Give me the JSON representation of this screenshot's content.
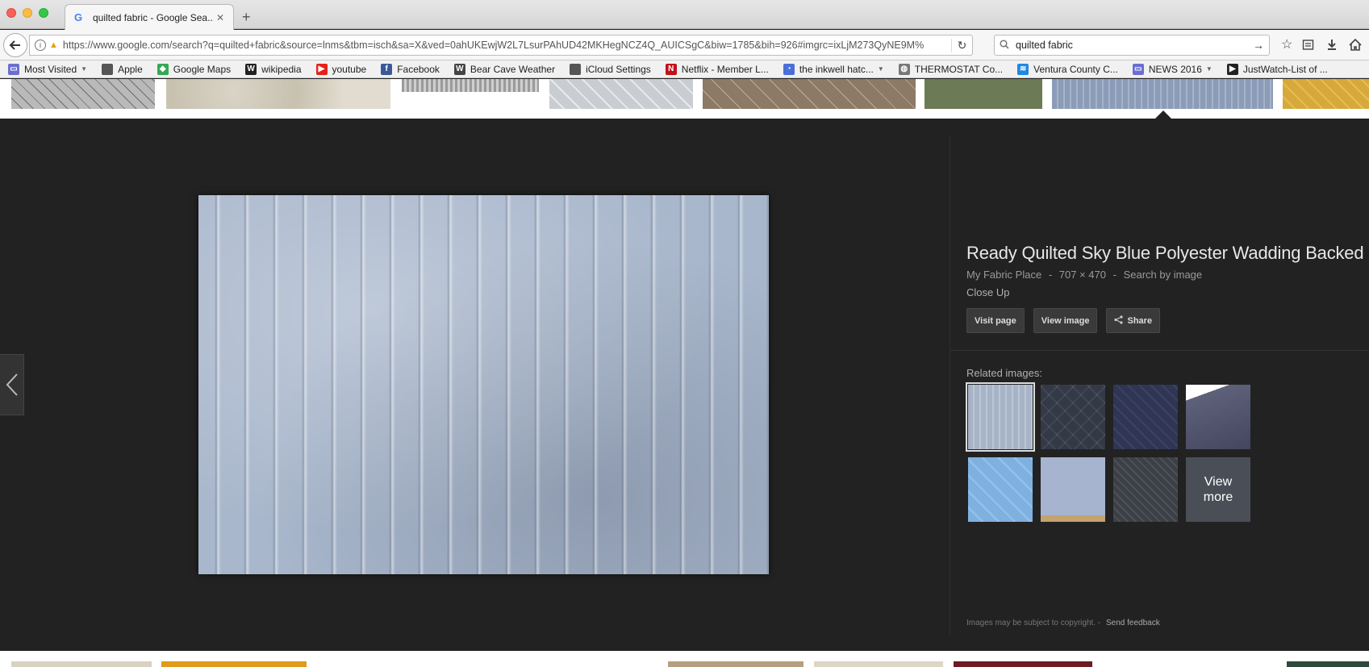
{
  "tab": {
    "title": "quilted fabric - Google Sea...",
    "favicon": "G",
    "close": "✕",
    "new_tab": "+"
  },
  "nav": {
    "url": "https://www.google.com/search?q=quilted+fabric&source=lnms&tbm=isch&sa=X&ved=0ahUKEwjW2L7LsurPAhUD42MKHegNCZ4Q_AUICSgC&biw=1785&bih=926#imgrc=ixLjM273QyNE9M%",
    "search_query": "quilted fabric"
  },
  "bookmarks": [
    {
      "label": "Most Visited",
      "icon": "folder-icon",
      "caret": true,
      "color": "#6a6fcf"
    },
    {
      "label": "Apple",
      "icon": "apple-icon",
      "caret": false,
      "color": "#555555"
    },
    {
      "label": "Google Maps",
      "icon": "maps-icon",
      "caret": false,
      "color": "#34a853"
    },
    {
      "label": "wikipedia",
      "icon": "wikipedia-icon",
      "caret": false,
      "color": "#222222"
    },
    {
      "label": "youtube",
      "icon": "youtube-icon",
      "caret": false,
      "color": "#e62117"
    },
    {
      "label": "Facebook",
      "icon": "facebook-icon",
      "caret": false,
      "color": "#3b5998"
    },
    {
      "label": "Bear Cave Weather",
      "icon": "weather-icon",
      "caret": false,
      "color": "#444444"
    },
    {
      "label": "iCloud Settings",
      "icon": "apple-icon",
      "caret": false,
      "color": "#555555"
    },
    {
      "label": "Netflix - Member L...",
      "icon": "netflix-icon",
      "caret": false,
      "color": "#c11119"
    },
    {
      "label": "the inkwell hatc...",
      "icon": "rss-icon",
      "caret": true,
      "color": "#4a6fd6"
    },
    {
      "label": "THERMOSTAT Co...",
      "icon": "globe-icon",
      "caret": false,
      "color": "#777777"
    },
    {
      "label": "Ventura County C...",
      "icon": "ventura-icon",
      "caret": false,
      "color": "#1e88e5"
    },
    {
      "label": "NEWS 2016",
      "icon": "folder-icon",
      "caret": true,
      "color": "#6a6fcf"
    },
    {
      "label": "JustWatch-List of ...",
      "icon": "justwatch-icon",
      "caret": false,
      "color": "#222222"
    }
  ],
  "detail": {
    "title": "Ready Quilted Sky Blue Polyester Wadding Backed",
    "source": "My Fabric Place",
    "sep1": "-",
    "dimensions": "707 × 470",
    "sep2": "-",
    "search_by_image": "Search by image",
    "description": "Close Up",
    "actions": {
      "visit": "Visit page",
      "view": "View image",
      "share": "Share"
    },
    "related_label": "Related images:",
    "view_more_line1": "View",
    "view_more_line2": "more",
    "copyright": "Images may be subject to copyright.",
    "sep3": "-",
    "feedback": "Send feedback"
  },
  "colors": {
    "viewer_bg": "#222222",
    "main_image": "#a9b7cc"
  }
}
